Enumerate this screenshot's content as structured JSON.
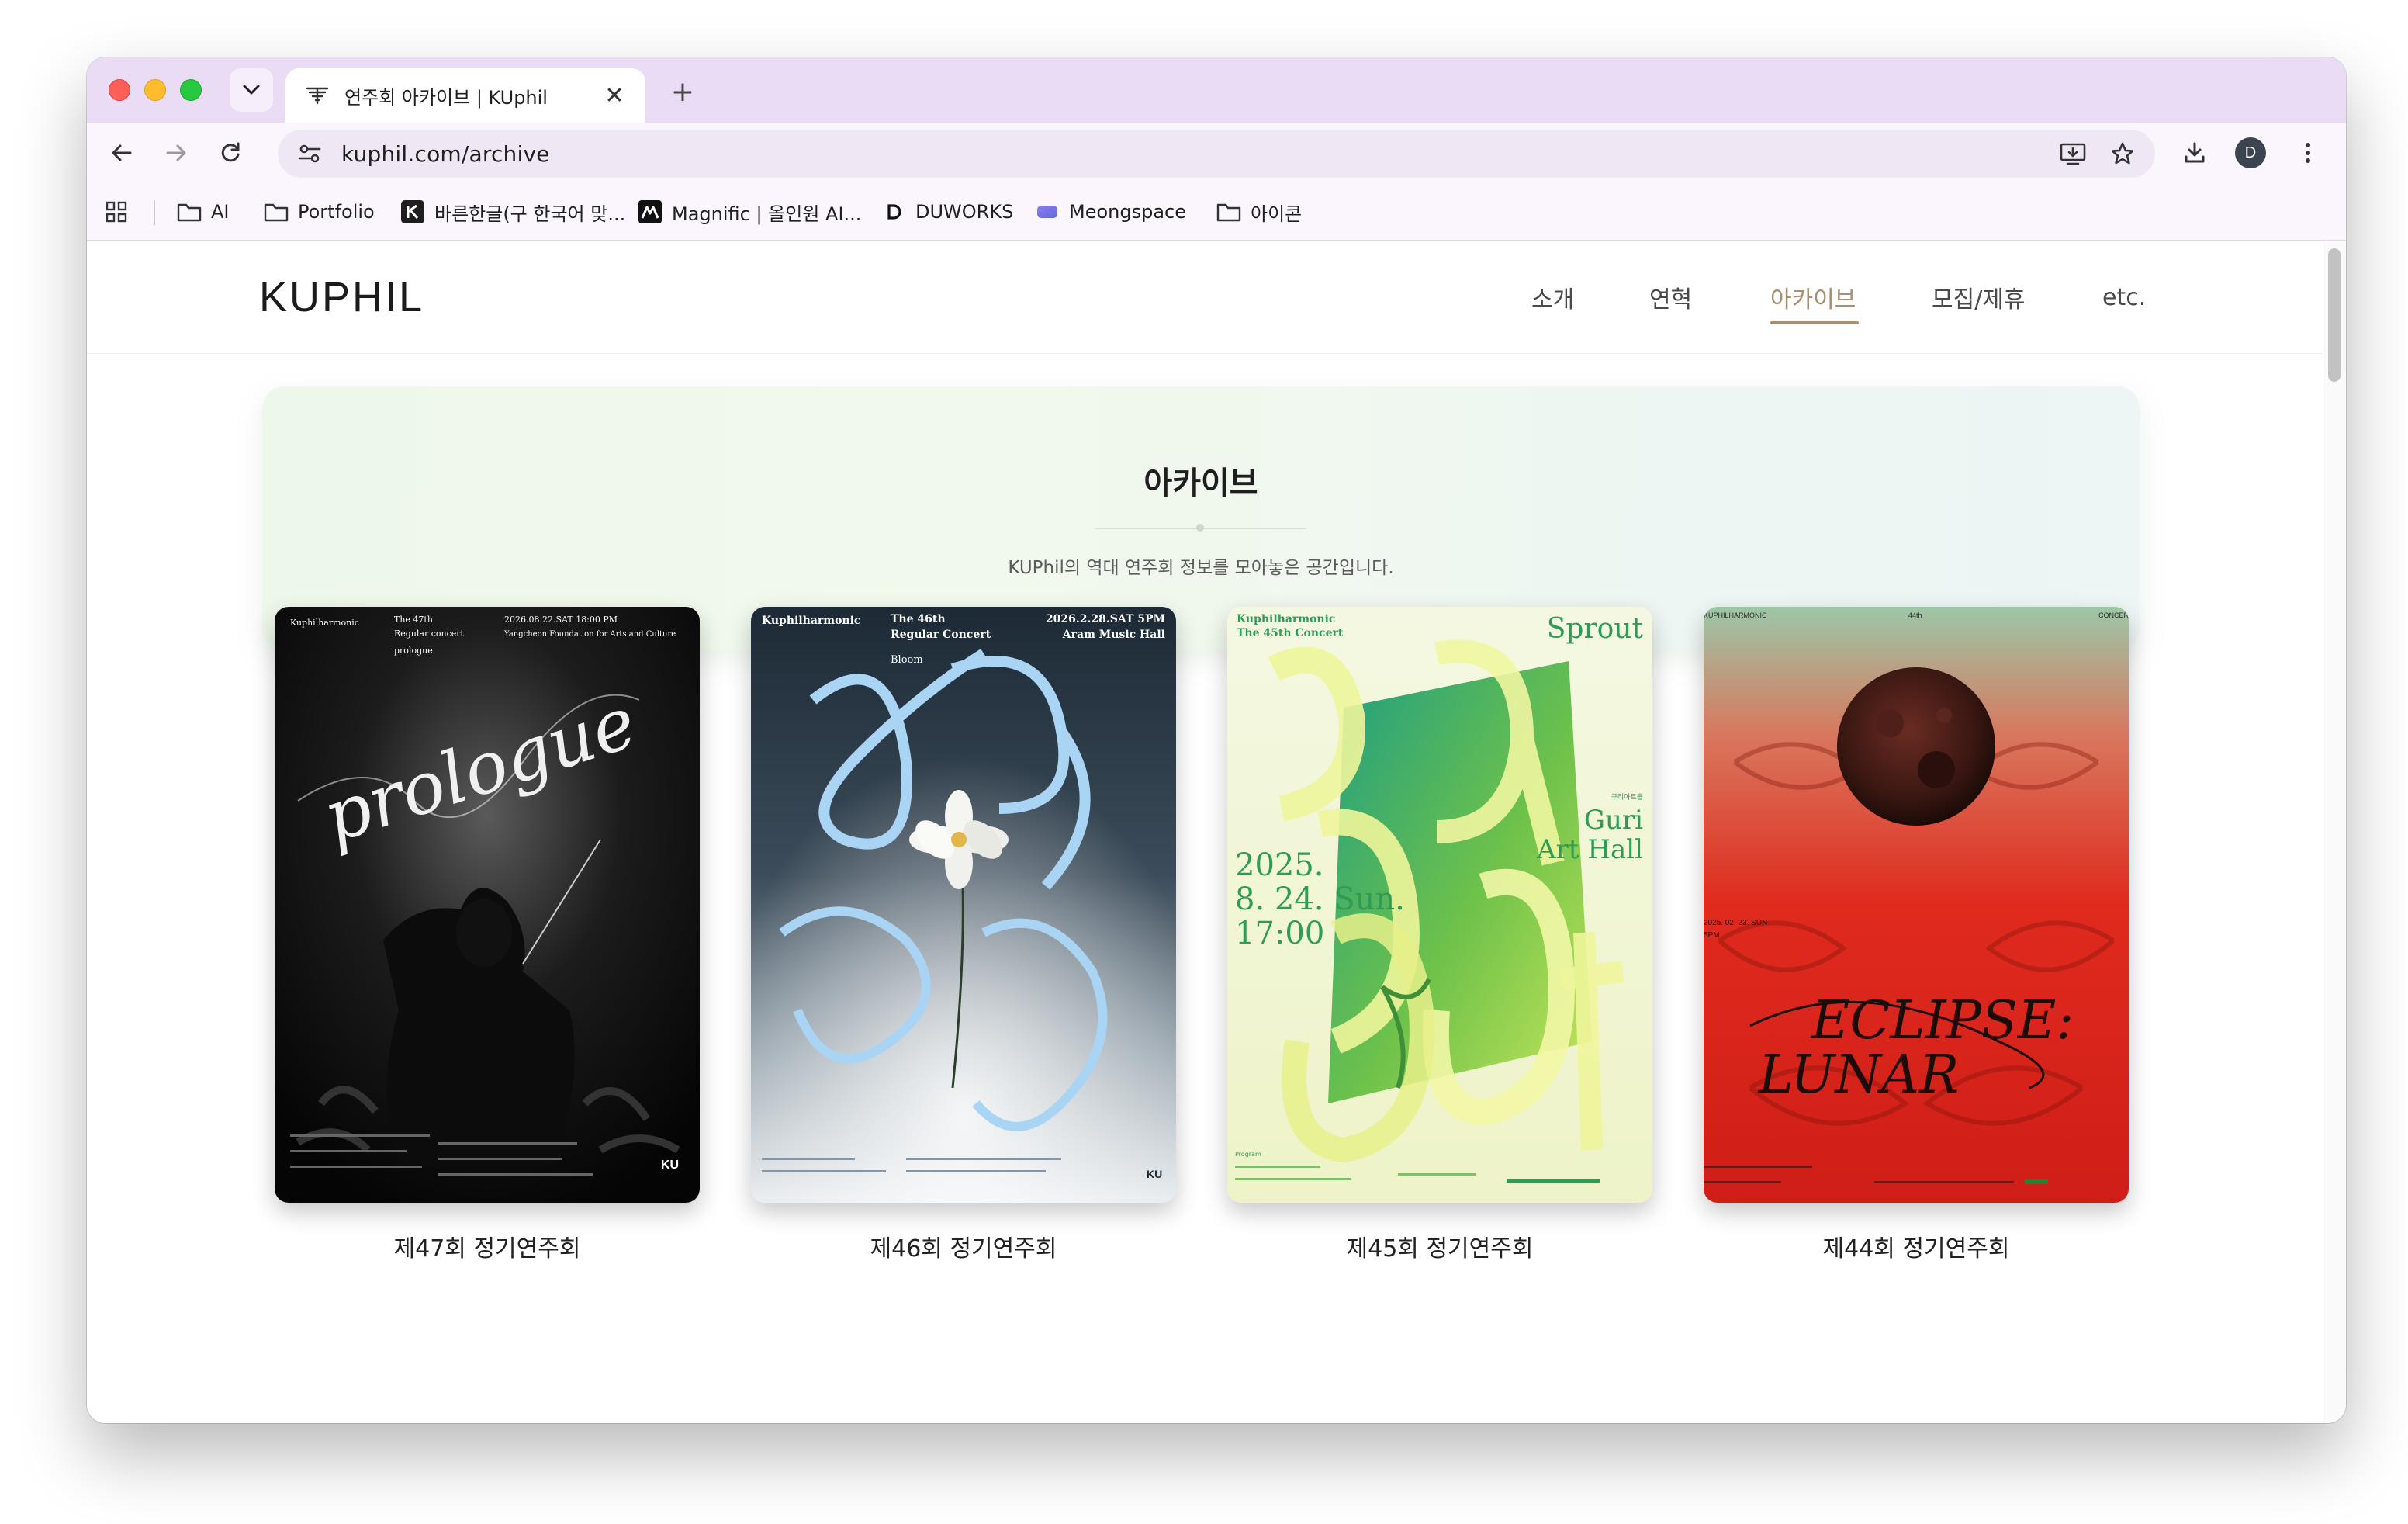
{
  "browser": {
    "tab_title": "연주회 아카이브 | KUphil",
    "url": "kuphil.com/archive",
    "profile_initial": "D",
    "bookmarks": [
      {
        "label": "AI",
        "icon": "folder-icon"
      },
      {
        "label": "Portfolio",
        "icon": "folder-icon"
      },
      {
        "label": "바른한글(구 한국어 맞...",
        "icon": "k-logo-icon"
      },
      {
        "label": "Magnific | 올인원 AI...",
        "icon": "magnific-logo-icon"
      },
      {
        "label": "DUWORKS",
        "icon": "duworks-logo-icon"
      },
      {
        "label": "Meongspace",
        "icon": "meongspace-logo-icon"
      },
      {
        "label": "아이콘",
        "icon": "folder-icon"
      }
    ]
  },
  "site": {
    "logo": "KUPHIL",
    "nav": [
      {
        "label": "소개",
        "active": false
      },
      {
        "label": "연혁",
        "active": false
      },
      {
        "label": "아카이브",
        "active": true
      },
      {
        "label": "모집/제휴",
        "active": false
      },
      {
        "label": "etc.",
        "active": false
      }
    ],
    "accent_color": "#a98f6e"
  },
  "hero": {
    "title": "아카이브",
    "description": "KUPhil의 역대 연주회 정보를 모아놓은 공간입니다."
  },
  "concerts": [
    {
      "label": "제47회 정기연주회",
      "poster": {
        "theme": "dark",
        "orchestra": "Kuphilharmonic",
        "edition": "The 47th",
        "subtitle": "Regular concert",
        "date": "2026.08.22.SAT 18:00 PM",
        "venue": "Yangcheon Foundation for Arts and Culture",
        "title": "prologue",
        "script": "prologue",
        "footer_logo": "KU"
      }
    },
    {
      "label": "제46회 정기연주회",
      "poster": {
        "theme": "blue",
        "orchestra": "Kuphilharmonic",
        "edition": "The 46th",
        "subtitle": "Regular Concert",
        "date": "2026.2.28.SAT 5PM",
        "venue": "Aram Music Hall",
        "title": "Bloom",
        "script": "Bloom",
        "footer_logo": "KU"
      }
    },
    {
      "label": "제45회 정기연주회",
      "poster": {
        "theme": "green",
        "orchestra": "Kuphilharmonic",
        "edition": "The 45th Concert",
        "title": "Sprout",
        "venue_kr": "구리아트홀",
        "venue_line1": "Guri",
        "venue_line2": "Art Hall",
        "date_line1": "2025.",
        "date_line2": "8. 24. Sun.",
        "date_line3": "17:00",
        "program": "Program"
      }
    },
    {
      "label": "제44회 정기연주회",
      "poster": {
        "theme": "red",
        "orchestra": "KUPHILHARMONIC",
        "edition": "44th",
        "corner": "CONCER",
        "date": "2025. 02. 23. SUN",
        "time": "5PM",
        "title_line1": "ECLIPSE:",
        "title_line2": "LUNAR"
      }
    }
  ]
}
